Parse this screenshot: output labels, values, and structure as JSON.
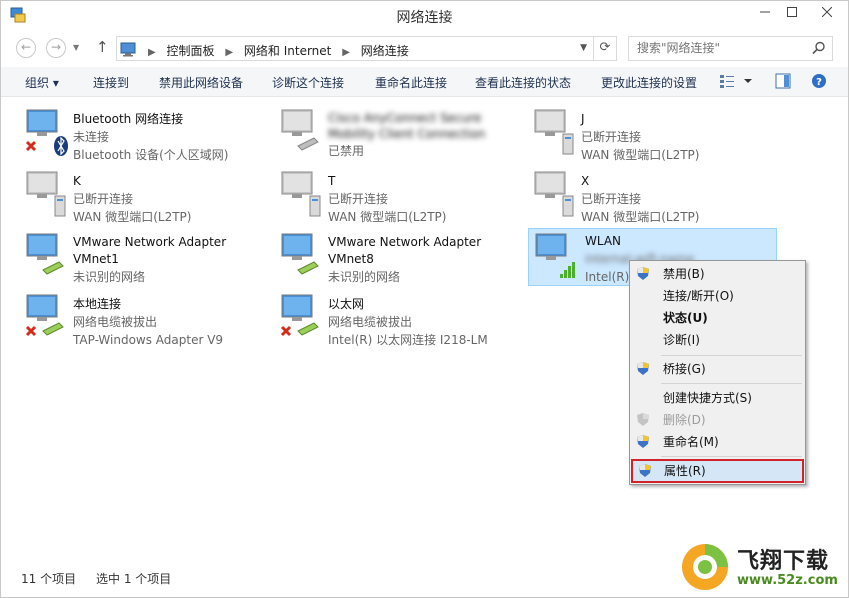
{
  "window": {
    "title": "网络连接",
    "controls": {
      "minimize": "–",
      "maximize": "□",
      "close": "✕"
    }
  },
  "address": {
    "crumbs": [
      "控制面板",
      "网络和 Internet",
      "网络连接"
    ],
    "search_placeholder": "搜索\"网络连接\""
  },
  "toolbar": {
    "organize": "组织 ▾",
    "connect_to": "连接到",
    "disable": "禁用此网络设备",
    "diagnose": "诊断这个连接",
    "rename": "重命名此连接",
    "view_status": "查看此连接的状态",
    "change_settings": "更改此连接的设置"
  },
  "connections": [
    {
      "name": "Bluetooth 网络连接",
      "status": "未连接",
      "device": "Bluetooth 设备(个人区域网)",
      "icon": "bluetooth-network-icon",
      "state": "disconnected"
    },
    {
      "name": "Cisco AnyConnect Secure Mobility Client Connection",
      "status": "已禁用",
      "device": "",
      "icon": "ethernet-adapter-icon",
      "state": "disabled"
    },
    {
      "name": "J",
      "status": "已断开连接",
      "device": "WAN 微型端口(L2TP)",
      "icon": "vpn-icon",
      "state": "disconnected"
    },
    {
      "name": "K",
      "status": "已断开连接",
      "device": "WAN 微型端口(L2TP)",
      "icon": "vpn-icon",
      "state": "disconnected"
    },
    {
      "name": "T",
      "status": "已断开连接",
      "device": "WAN 微型端口(L2TP)",
      "icon": "vpn-icon",
      "state": "disconnected"
    },
    {
      "name": "X",
      "status": "已断开连接",
      "device": "WAN 微型端口(L2TP)",
      "icon": "vpn-icon",
      "state": "disconnected"
    },
    {
      "name": "VMware Network Adapter VMnet1",
      "status": "未识别的网络",
      "device": "",
      "icon": "ethernet-adapter-icon",
      "state": "connected"
    },
    {
      "name": "VMware Network Adapter VMnet8",
      "status": "未识别的网络",
      "device": "",
      "icon": "ethernet-adapter-icon",
      "state": "connected"
    },
    {
      "name": "WLAN",
      "status": "internal-wifi-name",
      "device": "Intel(R)",
      "icon": "wifi-icon",
      "state": "connected"
    },
    {
      "name": "本地连接",
      "status": "网络电缆被拔出",
      "device": "TAP-Windows Adapter V9",
      "icon": "ethernet-adapter-icon",
      "state": "unplugged"
    },
    {
      "name": "以太网",
      "status": "网络电缆被拔出",
      "device": "Intel(R) 以太网连接 I218-LM",
      "icon": "ethernet-adapter-icon",
      "state": "unplugged"
    }
  ],
  "context_menu": [
    {
      "label": "禁用(B)",
      "shield": true
    },
    {
      "label": "连接/断开(O)",
      "shield": false
    },
    {
      "label": "状态(U)",
      "shield": false,
      "bold": true
    },
    {
      "label": "诊断(I)",
      "shield": false
    },
    {
      "label": "桥接(G)",
      "shield": true
    },
    {
      "label": "创建快捷方式(S)",
      "shield": false
    },
    {
      "label": "删除(D)",
      "shield": true,
      "disabled": true
    },
    {
      "label": "重命名(M)",
      "shield": true
    },
    {
      "label": "属性(R)",
      "shield": true,
      "highlighted": true
    }
  ],
  "status_bar": {
    "count": "11 个项目",
    "selected": "选中 1 个项目"
  },
  "watermark": {
    "text": "飞翔下载",
    "url": "www.52z.com"
  }
}
